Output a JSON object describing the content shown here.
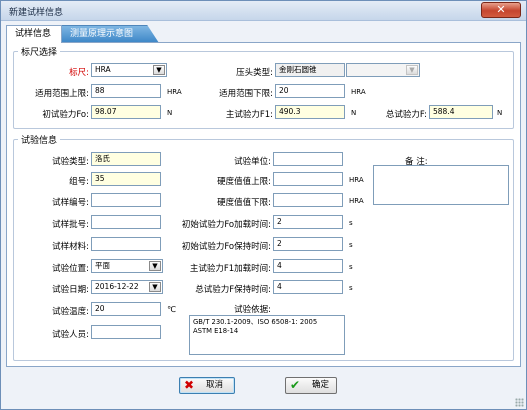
{
  "window": {
    "title": "新建试样信息",
    "close_glyph": "✕"
  },
  "tabs": [
    {
      "label": "试样信息",
      "active": true
    },
    {
      "label": "测量原理示意图",
      "active": false
    }
  ],
  "ruler_group": {
    "legend": "标尺选择",
    "scale_label": "标尺:",
    "scale_value": "HRA",
    "indenter_label": "压头类型:",
    "indenter_value": "金刚石圆锥",
    "range_upper_label": "适用范围上限:",
    "range_upper_value": "88",
    "range_upper_unit": "HRA",
    "range_lower_label": "适用范围下限:",
    "range_lower_value": "20",
    "range_lower_unit": "HRA",
    "initial_force_label": "初试验力Fo:",
    "initial_force_value": "98.07",
    "initial_force_unit": "N",
    "main_force_label": "主试验力F1:",
    "main_force_value": "490.3",
    "main_force_unit": "N",
    "total_force_label": "总试验力F:",
    "total_force_value": "588.4",
    "total_force_unit": "N"
  },
  "test_group": {
    "legend": "试验信息",
    "test_type_label": "试验类型:",
    "test_type_value": "洛氏",
    "test_unit_label": "试验单位:",
    "test_unit_value": "",
    "remarks_label": "备 注:",
    "remarks_value": "",
    "group_no_label": "组号:",
    "group_no_value": "35",
    "hardness_upper_label": "硬度值值上限:",
    "hardness_upper_value": "",
    "hardness_upper_unit": "HRA",
    "sample_no_label": "试样编号:",
    "sample_no_value": "",
    "hardness_lower_label": "硬度值值下限:",
    "hardness_lower_value": "",
    "hardness_lower_unit": "HRA",
    "batch_no_label": "试样批号:",
    "batch_no_value": "",
    "fo_load_time_label": "初始试验力Fo加载时间:",
    "fo_load_time_value": "2",
    "fo_load_time_unit": "s",
    "material_label": "试样材料:",
    "material_value": "",
    "fo_hold_time_label": "初始试验力Fo保持时间:",
    "fo_hold_time_value": "2",
    "fo_hold_time_unit": "s",
    "position_label": "试验位置:",
    "position_value": "平面",
    "f1_load_time_label": "主试验力F1加载时间:",
    "f1_load_time_value": "4",
    "f1_load_time_unit": "s",
    "date_label": "试验日期:",
    "date_value": "2016-12-22",
    "f_hold_time_label": "总试验力F保持时间:",
    "f_hold_time_value": "4",
    "f_hold_time_unit": "s",
    "temperature_label": "试验温度:",
    "temperature_value": "20",
    "temperature_unit": "℃",
    "basis_label": "试验依据:",
    "basis_value": "GB/T 230.1-2009、ISO 6508-1: 2005\nASTM E18-14",
    "operator_label": "试验人员:",
    "operator_value": ""
  },
  "buttons": {
    "cancel_label": "取消",
    "cancel_icon_glyph": "✖",
    "ok_label": "确定",
    "ok_icon_glyph": "✔"
  },
  "colors": {
    "required_label": "#d20000",
    "cancel_icon": "#d00000",
    "ok_icon": "#1a9a1a",
    "highlight_input": "#ffffe1",
    "tab_inactive": "#3f88c8"
  },
  "icons": {
    "dropdown_arrow": "▼"
  }
}
